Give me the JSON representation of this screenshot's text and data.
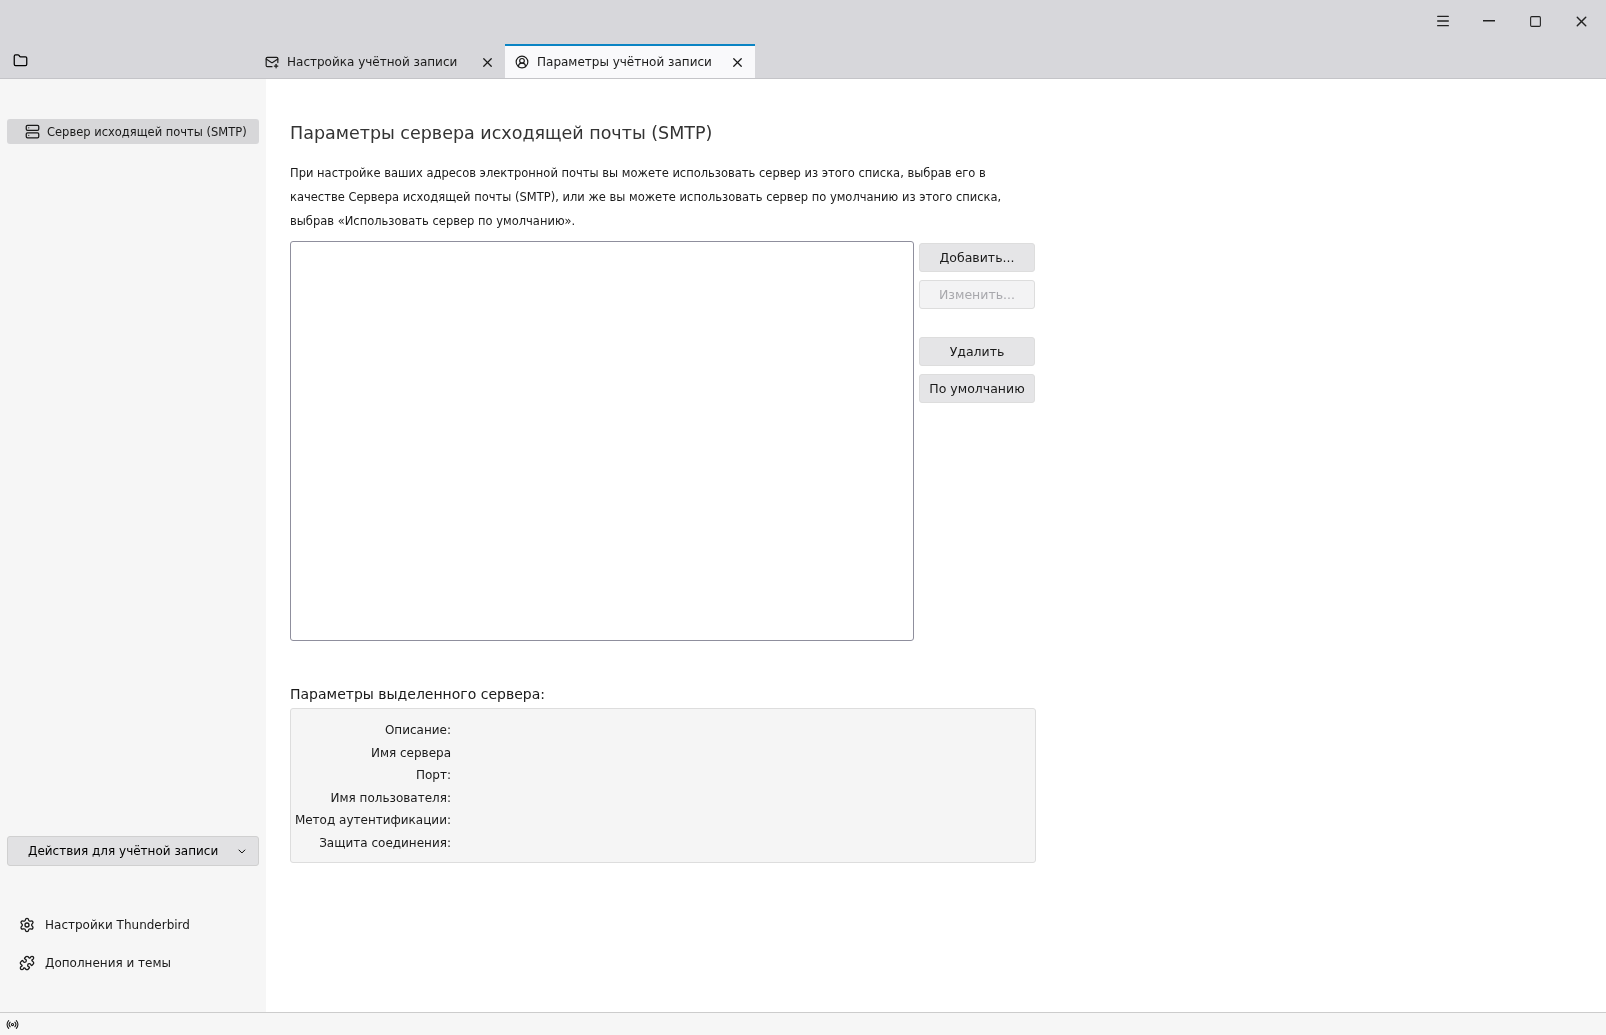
{
  "tabs": [
    {
      "label": "Настройка учётной записи",
      "selected": false
    },
    {
      "label": "Параметры учётной записи",
      "selected": true
    }
  ],
  "sidebar": {
    "items": [
      {
        "label": "Сервер исходящей почты (SMTP)",
        "selected": true
      }
    ],
    "actions_button": "Действия для учётной записи",
    "footer_links": [
      "Настройки Thunderbird",
      "Дополнения и темы"
    ]
  },
  "main": {
    "title": "Параметры сервера исходящей почты (SMTP)",
    "description": "При настройке ваших адресов электронной почты вы можете использовать сервер из этого списка, выбрав его в качестве Сервера исходящей почты (SMTP), или же вы можете использовать сервер по умолчанию из этого списка, выбрав «Использовать сервер по умолчанию».",
    "buttons": [
      {
        "label": "Добавить...",
        "disabled": false
      },
      {
        "label": "Изменить...",
        "disabled": true
      },
      {
        "label": "Удалить",
        "disabled": false
      },
      {
        "label": "По умолчанию",
        "disabled": false
      }
    ],
    "details_title": "Параметры выделенного сервера:",
    "details_labels": [
      "Описание:",
      "Имя сервера",
      "Порт:",
      "Имя пользователя:",
      "Метод аутентификации:",
      "Защита соединения:"
    ]
  }
}
